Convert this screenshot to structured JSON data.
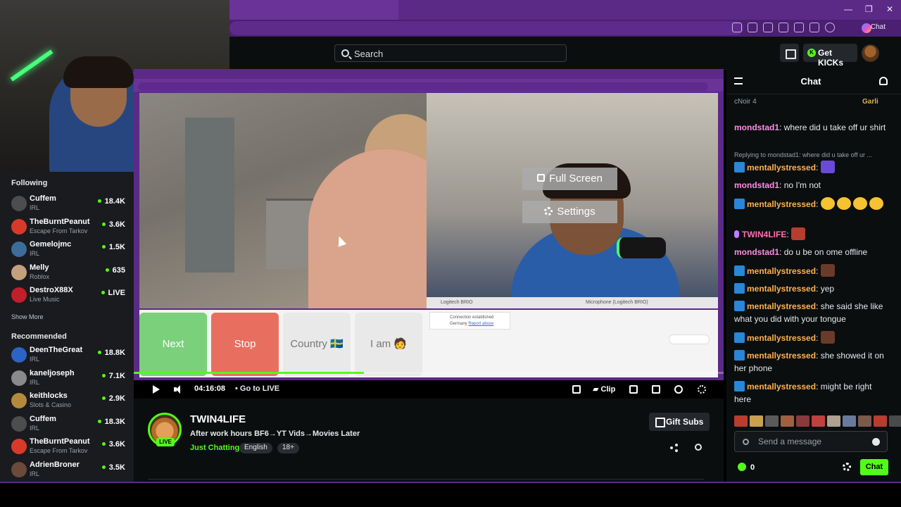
{
  "browser": {
    "window_controls": [
      "—",
      "❐",
      "✕"
    ],
    "copilot_label": "Chat"
  },
  "header": {
    "search_placeholder": "Search",
    "get_kicks": "Get KICKs"
  },
  "sidebar": {
    "following_title": "Following",
    "following": [
      {
        "name": "Cuffem",
        "category": "IRL",
        "viewers": "18.4K",
        "avatar_color": "#4d4d4d"
      },
      {
        "name": "TheBurntPeanut",
        "category": "Escape From Tarkov",
        "viewers": "3.6K",
        "avatar_color": "#d83a2a"
      },
      {
        "name": "Gemelojmc",
        "category": "IRL",
        "viewers": "1.5K",
        "avatar_color": "#3d6c9a"
      },
      {
        "name": "Melly",
        "category": "Roblox",
        "viewers": "635",
        "avatar_color": "#c5a07c"
      },
      {
        "name": "DestroX88X",
        "category": "Live Music",
        "viewers": "LIVE",
        "avatar_color": "#c21f2a"
      }
    ],
    "show_more": "Show More",
    "recommended_title": "Recommended",
    "recommended": [
      {
        "name": "DeenTheGreat",
        "category": "IRL",
        "viewers": "18.8K",
        "avatar_color": "#2c63c4"
      },
      {
        "name": "kaneljoseph",
        "category": "IRL",
        "viewers": "7.1K",
        "avatar_color": "#8a8a8a"
      },
      {
        "name": "keithlocks",
        "category": "Slots & Casino",
        "viewers": "2.9K",
        "avatar_color": "#b58a3a"
      },
      {
        "name": "Cuffem",
        "category": "IRL",
        "viewers": "18.3K",
        "avatar_color": "#4d4d4d"
      },
      {
        "name": "TheBurntPeanut",
        "category": "Escape From Tarkov",
        "viewers": "3.6K",
        "avatar_color": "#d83a2a"
      },
      {
        "name": "AdrienBroner",
        "category": "IRL",
        "viewers": "3.5K",
        "avatar_color": "#6a4a3a"
      }
    ]
  },
  "video": {
    "overlay_fullscreen": "Full Screen",
    "overlay_settings": "Settings",
    "device_camera": "Logitech BRIO",
    "device_mic": "Microphone (Logitech BRIO)",
    "buttons": {
      "next": "Next",
      "stop": "Stop",
      "country": "Country 🇸🇪",
      "iam": "I am 🧑"
    },
    "connection_text": "Connection established",
    "connection_country": "Germany",
    "report_abuse": "Report abuse",
    "progress": 0.39
  },
  "controls": {
    "time": "04:16:08",
    "go_live": "Go to LIVE",
    "clip": "Clip"
  },
  "stream": {
    "live_badge": "LIVE",
    "name": "TWIN4LIFE",
    "title": "After work hours BF6→YT Vids→Movies Later",
    "category": "Just Chatting",
    "tags": [
      "English",
      "18+"
    ],
    "gift_subs": "Gift Subs"
  },
  "chat": {
    "title": "Chat",
    "pinned_user": "cNoir",
    "pinned_count": "4",
    "pinned_right": "Garli",
    "messages": [
      {
        "user": "mondstad1",
        "text": "where did u take off ur shirt",
        "color": "pink"
      },
      {
        "reply": "Replying to mondstad1: where did u take off ur ..."
      },
      {
        "user": "mentallystressed",
        "text": "",
        "color": "orange",
        "emote": "purple"
      },
      {
        "user": "mondstad1",
        "text": "no I'm not",
        "color": "pink"
      },
      {
        "user": "mentallystressed",
        "text": "",
        "color": "orange",
        "emote": "yellow"
      },
      {
        "user": "TWIN4LIFE",
        "text": "",
        "color": "pink2",
        "emote": "red"
      },
      {
        "user": "mondstad1",
        "text": "do u be on ome offline",
        "color": "pink"
      },
      {
        "user": "mentallystressed",
        "text": "",
        "color": "orange",
        "emote": "dark"
      },
      {
        "user": "mentallystressed",
        "text": "yep",
        "color": "orange"
      },
      {
        "user": "mentallystressed",
        "text": "she said she like what you did with your tongue",
        "color": "orange"
      },
      {
        "user": "mentallystressed",
        "text": "",
        "color": "orange",
        "emote": "dark"
      },
      {
        "user": "mentallystressed",
        "text": "she showed it on her phone",
        "color": "orange"
      },
      {
        "user": "mentallystressed",
        "text": "might be right here",
        "color": "orange"
      }
    ],
    "send_placeholder": "Send a message",
    "kicks": "0",
    "chat_button": "Chat"
  }
}
